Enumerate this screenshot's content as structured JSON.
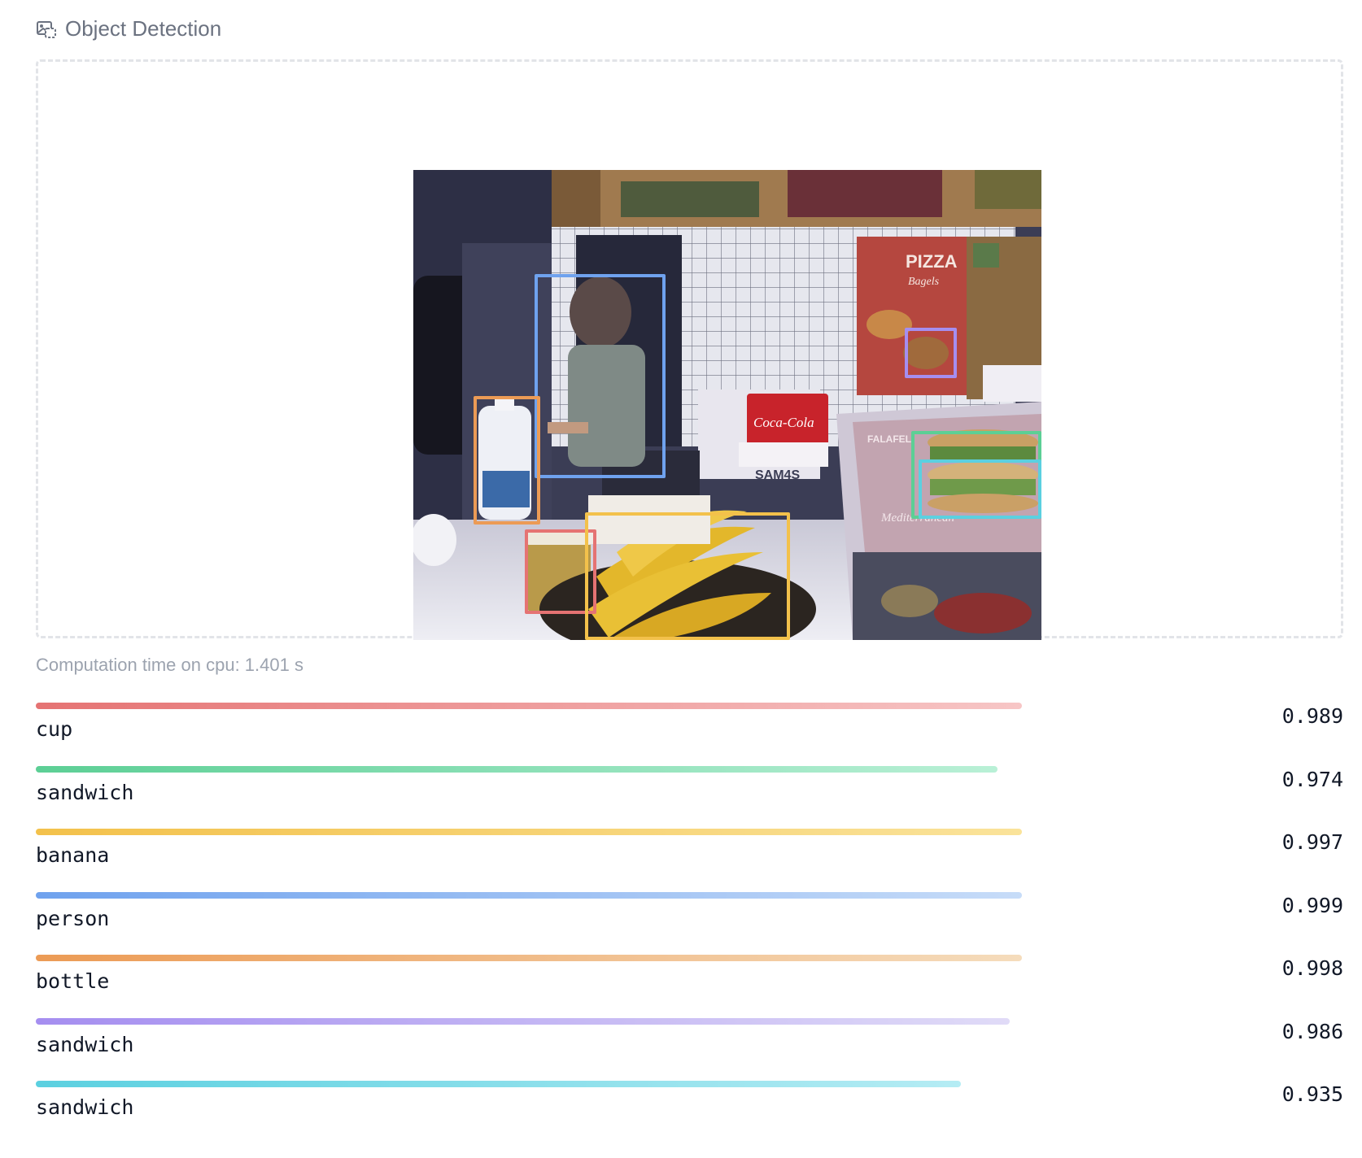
{
  "header": {
    "title": "Object Detection",
    "icon": "image-detection-icon"
  },
  "computation": {
    "text": "Computation time on cpu: 1.401 s"
  },
  "detections": [
    {
      "label": "cup",
      "score": "0.989",
      "color": "#e57373"
    },
    {
      "label": "sandwich",
      "score": "0.974",
      "color": "#5ccf95"
    },
    {
      "label": "banana",
      "score": "0.997",
      "color": "#f3c14b"
    },
    {
      "label": "person",
      "score": "0.999",
      "color": "#6fa2ee"
    },
    {
      "label": "bottle",
      "score": "0.998",
      "color": "#ec9b55"
    },
    {
      "label": "sandwich",
      "score": "0.986",
      "color": "#a58ef0"
    },
    {
      "label": "sandwich",
      "score": "0.935",
      "color": "#5bd0e0"
    }
  ],
  "photo_text": {
    "coke": "Coca-Cola",
    "register": "SAM4S",
    "pizza": "PIZZA",
    "bagels": "Bagels",
    "falafel": "FALAFEL",
    "mediterranean": "Mediterranean"
  }
}
